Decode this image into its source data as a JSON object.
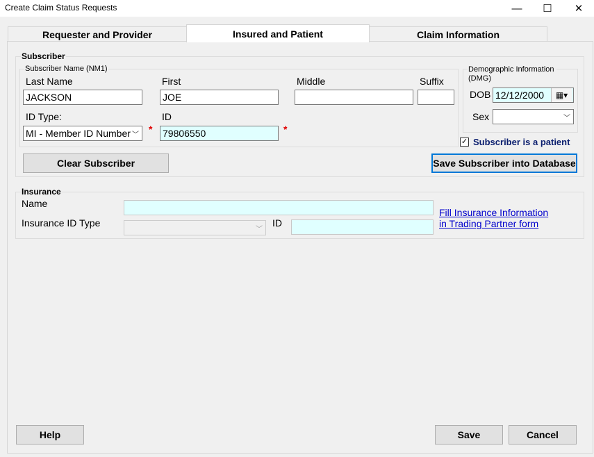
{
  "window": {
    "title": "Create Claim Status Requests"
  },
  "tabs": [
    "Requester and Provider",
    "Insured and Patient",
    "Claim Information"
  ],
  "subscriber": {
    "group_title": "Subscriber",
    "name_group_title": "Subscriber Name (NM1)",
    "last_name_label": "Last Name",
    "last_name_value": "JACKSON",
    "first_label": "First",
    "first_value": "JOE",
    "middle_label": "Middle",
    "middle_value": "",
    "suffix_label": "Suffix",
    "suffix_value": "",
    "id_type_label": "ID Type:",
    "id_type_value": "MI - Member ID Number",
    "id_label": "ID",
    "id_value": "79806550",
    "required_mark": "*",
    "demo_group_title": "Demographic Information (DMG)",
    "dob_label": "DOB",
    "dob_value": "12/12/2000",
    "sex_label": "Sex",
    "sex_value": "",
    "is_patient_label": "Subscriber is a patient",
    "is_patient_checked": "✓",
    "clear_button": "Clear Subscriber",
    "save_db_button": "Save Subscriber into Database"
  },
  "insurance": {
    "group_title": "Insurance",
    "name_label": "Name",
    "name_value": "",
    "id_type_label": "Insurance ID Type",
    "id_type_value": "",
    "id_label": "ID",
    "id_value": "",
    "fill_link_line1": "Fill Insurance Information",
    "fill_link_line2": "in Trading Partner form"
  },
  "footer": {
    "help_button": "Help",
    "save_button": "Save",
    "cancel_button": "Cancel"
  },
  "icons": {
    "minimize": "—",
    "maximize": "☐",
    "close": "✕",
    "dropdown": "﹀",
    "calendar": "▦"
  }
}
